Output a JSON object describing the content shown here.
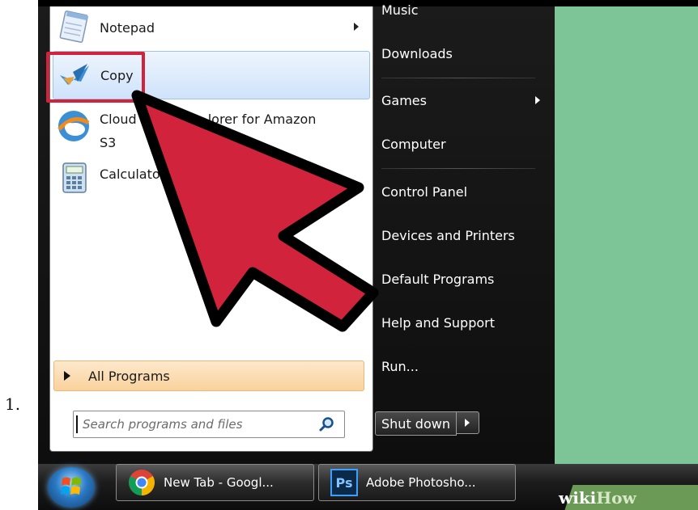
{
  "step": {
    "number": "1."
  },
  "start_menu": {
    "programs": [
      {
        "label": "Notepad",
        "icon": "notepad-icon",
        "has_submenu": true
      },
      {
        "label": "Copy",
        "icon": "copy-app-icon",
        "highlighted": true
      },
      {
        "label_line1": "Cloud",
        "label_line1_suffix": "lorer for Amazon",
        "label_line2": "S3",
        "icon": "cloudberry-icon"
      },
      {
        "label": "Calculato",
        "icon": "calculator-icon"
      }
    ],
    "all_programs": {
      "label": "All Programs"
    },
    "search": {
      "placeholder": "Search programs and files"
    },
    "places": [
      {
        "label": "Music"
      },
      {
        "label": "Downloads"
      },
      {
        "label": "Games",
        "has_submenu": true
      },
      {
        "label": "Computer"
      },
      {
        "label": "Control Panel"
      },
      {
        "label": "Devices and Printers"
      },
      {
        "label": "Default Programs"
      },
      {
        "label": "Help and Support"
      },
      {
        "label": "Run..."
      }
    ],
    "shutdown": {
      "label": "Shut down"
    }
  },
  "taskbar": {
    "items": [
      {
        "label": "New Tab - Googl...",
        "icon": "chrome-icon"
      },
      {
        "label": "Adobe Photosho...",
        "icon": "photoshop-icon",
        "icon_text": "Ps"
      }
    ]
  },
  "watermark": {
    "part1": "wiki",
    "part2": "How"
  },
  "colors": {
    "highlight_border": "#d2233c",
    "arrow_fill": "#d2233c",
    "desktop": "#7dc596",
    "all_programs_bg": "#f9d29c"
  }
}
